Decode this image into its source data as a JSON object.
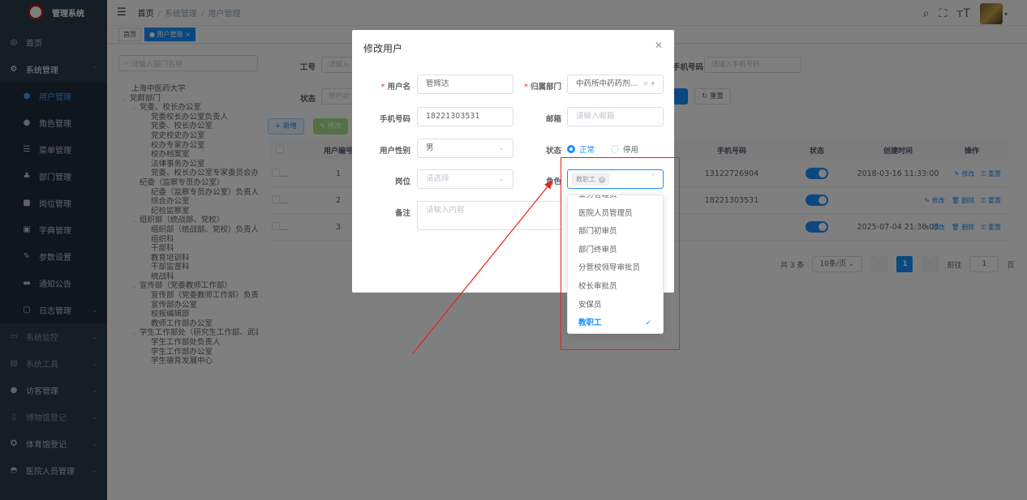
{
  "app": {
    "title": "管理系统"
  },
  "sidebar": {
    "items": [
      {
        "label": "首页",
        "icon": "dashboard-icon"
      },
      {
        "label": "系统管理",
        "icon": "gear-icon"
      },
      {
        "label": "用户管理",
        "icon": "user-icon"
      },
      {
        "label": "角色管理",
        "icon": "users-icon"
      },
      {
        "label": "菜单管理",
        "icon": "tree-table-icon"
      },
      {
        "label": "部门管理",
        "icon": "org-tree-icon"
      },
      {
        "label": "岗位管理",
        "icon": "post-icon"
      },
      {
        "label": "字典管理",
        "icon": "dict-icon"
      },
      {
        "label": "参数设置",
        "icon": "edit-icon"
      },
      {
        "label": "通知公告",
        "icon": "message-icon"
      },
      {
        "label": "日志管理",
        "icon": "log-icon"
      },
      {
        "label": "系统监控",
        "icon": "monitor-icon"
      },
      {
        "label": "系统工具",
        "icon": "tool-icon"
      },
      {
        "label": "访客管理",
        "icon": "visitor-icon"
      },
      {
        "label": "博物馆登记",
        "icon": "museum-icon"
      },
      {
        "label": "体育馆登记",
        "icon": "gym-icon"
      },
      {
        "label": "医院人员管理",
        "icon": "hospital-icon"
      }
    ]
  },
  "header": {
    "breadcrumb": [
      "首页",
      "系统管理",
      "用户管理"
    ]
  },
  "tags": {
    "home": "首页",
    "current": "用户管理"
  },
  "dept_tree": {
    "placeholder": "请输入部门名称",
    "nodes": [
      "上海中医药大学",
      "党群部门",
      "党委、校长办公室",
      "党委校长办公室负责人",
      "党委、校长办公室",
      "党史校史办公室",
      "校办专家办公室",
      "校办档案室",
      "法律事务办公室",
      "党委、校长办公室专家委员会办公室",
      "纪委（监察专员办公室）",
      "纪委（监察专员办公室）负责人",
      "综合办公室",
      "纪检监察室",
      "组织部（统战部、党校）",
      "组织部（统战部、党校）负责人",
      "组织科",
      "干部科",
      "教育培训科",
      "干部监督科",
      "统战科",
      "宣传部（党委教师工作部）",
      "宣传部（党委教师工作部）负责人",
      "宣传部办公室",
      "校报编辑部",
      "教师工作部办公室",
      "学生工作部处（研究生工作部、武装部）",
      "学生工作部处负责人",
      "学生工作部办公室",
      "学生德育发展中心"
    ]
  },
  "filters": {
    "job_no_label": "工号",
    "job_no_placeholder": "请输入",
    "phone_label": "手机号码",
    "phone_placeholder": "请输入手机号码",
    "status_label": "状态",
    "status_placeholder": "用户状",
    "reset": "重置"
  },
  "toolbar": {
    "add": "+ 新增",
    "edit": "修改"
  },
  "table": {
    "headers": {
      "user_no": "用户编号",
      "phone": "手机号码",
      "status": "状态",
      "created": "创建时间",
      "ops": "操作"
    },
    "rows": [
      {
        "chk": "...",
        "no": "1",
        "phone": "13122726904",
        "created": "2018-03-16 11:33:00",
        "ops": [
          "修改",
          "重置"
        ]
      },
      {
        "chk": "...",
        "no": "2",
        "phone": "18221303531",
        "created": "",
        "ops": [
          "修改",
          "删除",
          "重置"
        ]
      },
      {
        "chk": "...",
        "no": "3",
        "phone": "",
        "created": "2025-07-04 21:36:03",
        "ops": [
          "修改",
          "删除",
          "重置"
        ]
      }
    ]
  },
  "pager": {
    "total": "共 3 条",
    "size": "10条/页",
    "current": "1",
    "goto": "前往",
    "goto_value": "1",
    "page_unit": "页"
  },
  "dialog": {
    "title": "修改用户",
    "username_label": "用户名",
    "username": "管辉达",
    "dept_label": "归属部门",
    "dept": "中药所中药药剂...",
    "phone_label": "手机号码",
    "phone": "18221303531",
    "email_label": "邮箱",
    "email_placeholder": "请输入邮箱",
    "gender_label": "用户性别",
    "gender": "男",
    "status_label": "状态",
    "status_on": "正常",
    "status_off": "停用",
    "post_label": "岗位",
    "post_placeholder": "请选择",
    "role_label": "角色",
    "role_tag": "教职工",
    "remark_label": "备注",
    "remark_placeholder": "请输入内容"
  },
  "role_dropdown": {
    "options": [
      "业务管理员",
      "医院人员管理员",
      "部门初审员",
      "部门终审员",
      "分管校领导审批员",
      "校长审批员",
      "安保员",
      "教职工"
    ],
    "selected": "教职工"
  },
  "colors": {
    "sidebar": "#2b3a4a",
    "accent": "#1890ff",
    "annotation": "#e8221a"
  }
}
